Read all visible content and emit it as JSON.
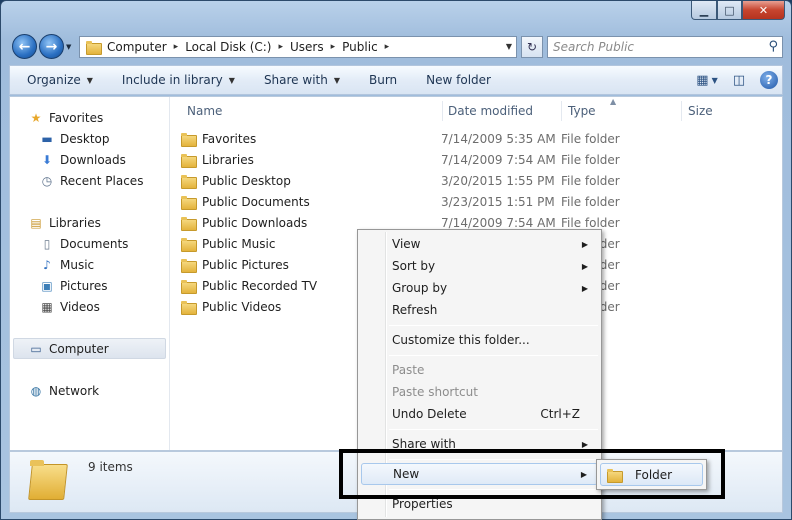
{
  "window": {
    "caption_min": "▁",
    "caption_max": "□",
    "caption_close": "✕"
  },
  "nav": {
    "back": "←",
    "forward": "→",
    "dropdown": "▼"
  },
  "address": {
    "crumbs": [
      "Computer",
      "Local Disk (C:)",
      "Users",
      "Public"
    ],
    "separator": "▸",
    "dropdown": "▼",
    "refresh": "↻"
  },
  "search": {
    "placeholder": "Search Public",
    "icon": "search-icon",
    "glyph": "⚲"
  },
  "toolbar": {
    "organize": "Organize",
    "include_in_library": "Include in library",
    "share_with": "Share with",
    "burn": "Burn",
    "new_folder": "New folder",
    "dd": "▼",
    "views_glyph": "▦",
    "preview_glyph": "◫",
    "help": "?"
  },
  "sidebar": {
    "favorites": {
      "label": "Favorites",
      "icon": "star-icon",
      "glyph": "★"
    },
    "favorites_items": [
      {
        "label": "Desktop",
        "icon": "desktop-icon",
        "glyph": "▬"
      },
      {
        "label": "Downloads",
        "icon": "downloads-icon",
        "glyph": "⬇"
      },
      {
        "label": "Recent Places",
        "icon": "recent-places-icon",
        "glyph": "◷"
      }
    ],
    "libraries": {
      "label": "Libraries",
      "icon": "libraries-icon",
      "glyph": "▤"
    },
    "libraries_items": [
      {
        "label": "Documents",
        "icon": "documents-icon",
        "glyph": "▯"
      },
      {
        "label": "Music",
        "icon": "music-icon",
        "glyph": "♪"
      },
      {
        "label": "Pictures",
        "icon": "pictures-icon",
        "glyph": "▣"
      },
      {
        "label": "Videos",
        "icon": "videos-icon",
        "glyph": "▦"
      }
    ],
    "computer": {
      "label": "Computer",
      "icon": "computer-icon",
      "glyph": "▭"
    },
    "network": {
      "label": "Network",
      "icon": "network-icon",
      "glyph": "◍"
    }
  },
  "columns": {
    "name": "Name",
    "date": "Date modified",
    "type": "Type",
    "size": "Size",
    "sort_arrow": "▲"
  },
  "files": [
    {
      "name": "Favorites",
      "date": "7/14/2009 5:35 AM",
      "type": "File folder"
    },
    {
      "name": "Libraries",
      "date": "7/14/2009 7:54 AM",
      "type": "File folder"
    },
    {
      "name": "Public Desktop",
      "date": "3/20/2015 1:55 PM",
      "type": "File folder"
    },
    {
      "name": "Public Documents",
      "date": "3/23/2015 1:51 PM",
      "type": "File folder"
    },
    {
      "name": "Public Downloads",
      "date": "7/14/2009 7:54 AM",
      "type": "File folder"
    },
    {
      "name": "Public Music",
      "date": "",
      "type": "File folder"
    },
    {
      "name": "Public Pictures",
      "date": "",
      "type": "File folder"
    },
    {
      "name": "Public Recorded TV",
      "date": "",
      "type": "File folder"
    },
    {
      "name": "Public Videos",
      "date": "",
      "type": "File folder"
    }
  ],
  "status": {
    "count": "9 items"
  },
  "context_menu": {
    "view": "View",
    "sort_by": "Sort by",
    "group_by": "Group by",
    "refresh": "Refresh",
    "customize": "Customize this folder...",
    "paste": "Paste",
    "paste_shortcut": "Paste shortcut",
    "undo_delete": "Undo Delete",
    "undo_shortcut": "Ctrl+Z",
    "share_with": "Share with",
    "new": "New",
    "properties": "Properties",
    "arrow": "▶"
  },
  "submenu": {
    "folder": "Folder"
  }
}
